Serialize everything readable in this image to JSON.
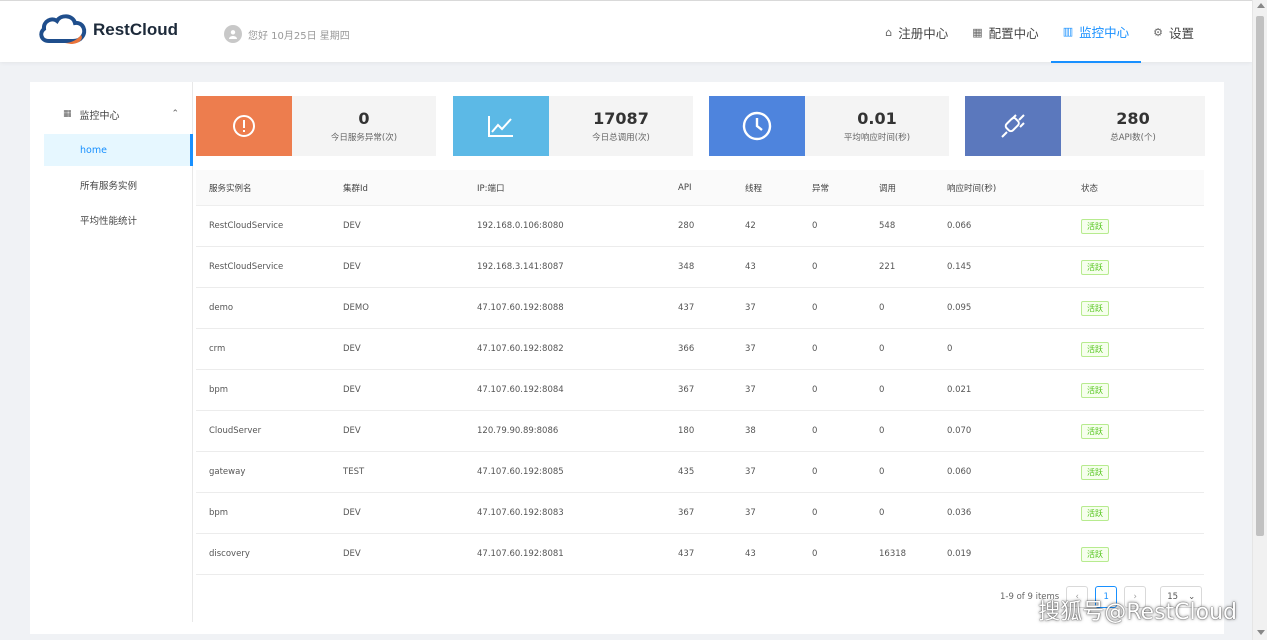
{
  "app": {
    "brand": "RestCloud"
  },
  "header": {
    "greeting": "您好 10月25日 星期四",
    "nav": [
      {
        "label": "注册中心",
        "icon": "home-icon"
      },
      {
        "label": "配置中心",
        "icon": "grid-icon"
      },
      {
        "label": "监控中心",
        "icon": "bar-chart-icon",
        "active": true
      },
      {
        "label": "设置",
        "icon": "gear-icon"
      }
    ]
  },
  "sidebar": {
    "title": "监控中心",
    "items": [
      {
        "label": "home",
        "active": true
      },
      {
        "label": "所有服务实例"
      },
      {
        "label": "平均性能统计"
      }
    ]
  },
  "stats": [
    {
      "value": "0",
      "label": "今日服务异常(次)",
      "color": "#ed7d4e",
      "icon": "alert-icon"
    },
    {
      "value": "17087",
      "label": "今日总调用(次)",
      "color": "#5cb9e6",
      "icon": "line-chart-icon"
    },
    {
      "value": "0.01",
      "label": "平均响应时间(秒)",
      "color": "#4e84dd",
      "icon": "clock-icon"
    },
    {
      "value": "280",
      "label": "总API数(个)",
      "color": "#5b78bd",
      "icon": "plug-icon"
    }
  ],
  "table": {
    "columns": [
      "服务实例名",
      "集群Id",
      "IP:端口",
      "API",
      "线程",
      "异常",
      "调用",
      "响应时间(秒)",
      "状态"
    ],
    "rows": [
      [
        "RestCloudService",
        "DEV",
        "192.168.0.106:8080",
        "280",
        "42",
        "0",
        "548",
        "0.066",
        "活跃"
      ],
      [
        "RestCloudService",
        "DEV",
        "192.168.3.141:8087",
        "348",
        "43",
        "0",
        "221",
        "0.145",
        "活跃"
      ],
      [
        "demo",
        "DEMO",
        "47.107.60.192:8088",
        "437",
        "37",
        "0",
        "0",
        "0.095",
        "活跃"
      ],
      [
        "crm",
        "DEV",
        "47.107.60.192:8082",
        "366",
        "37",
        "0",
        "0",
        "0",
        "活跃"
      ],
      [
        "bpm",
        "DEV",
        "47.107.60.192:8084",
        "367",
        "37",
        "0",
        "0",
        "0.021",
        "活跃"
      ],
      [
        "CloudServer",
        "DEV",
        "120.79.90.89:8086",
        "180",
        "38",
        "0",
        "0",
        "0.070",
        "活跃"
      ],
      [
        "gateway",
        "TEST",
        "47.107.60.192:8085",
        "435",
        "37",
        "0",
        "0",
        "0.060",
        "活跃"
      ],
      [
        "bpm",
        "DEV",
        "47.107.60.192:8083",
        "367",
        "37",
        "0",
        "0",
        "0.036",
        "活跃"
      ],
      [
        "discovery",
        "DEV",
        "47.107.60.192:8081",
        "437",
        "43",
        "0",
        "16318",
        "0.019",
        "活跃"
      ]
    ]
  },
  "pagination": {
    "summary": "1-9 of 9 items",
    "current_page": "1",
    "page_size": "15"
  },
  "overlay_watermark": "搜狐号@RestCloud"
}
